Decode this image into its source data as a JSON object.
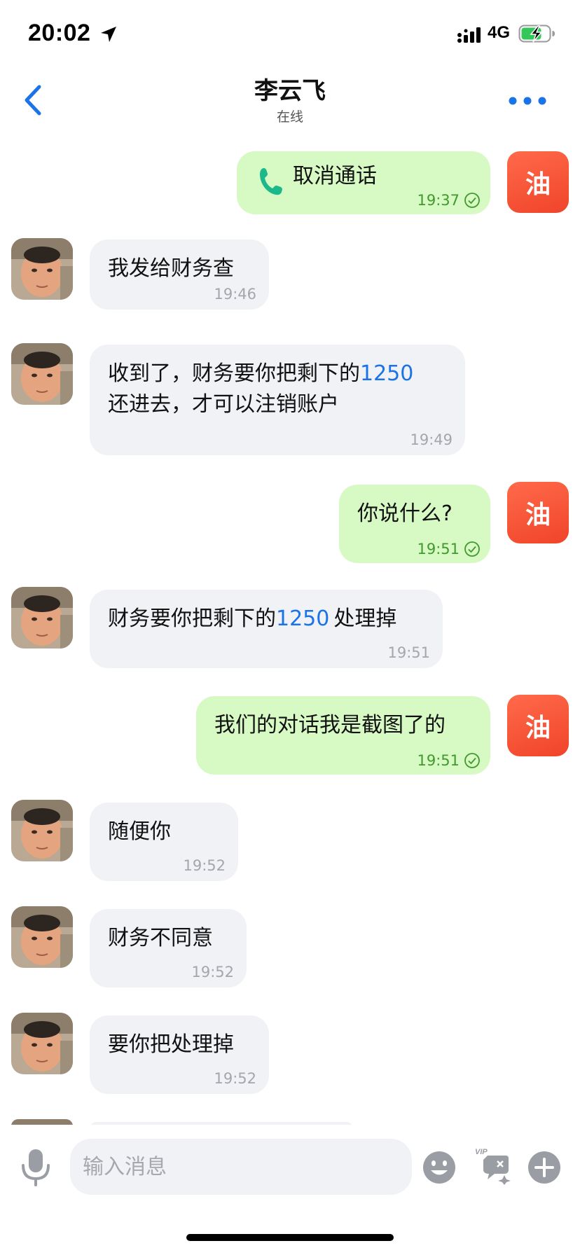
{
  "status_bar": {
    "time": "20:02",
    "network": "4G"
  },
  "nav": {
    "contact_name": "李云飞",
    "contact_status": "在线"
  },
  "colors": {
    "accent": "#1a73e8",
    "outgoing_bubble": "#d7f9c4",
    "incoming_bubble": "#f1f2f6",
    "outgoing_avatar": "#f0442a",
    "read_check": "#3f9a2b"
  },
  "my_avatar_text": "油",
  "messages": [
    {
      "direction": "out",
      "type": "call",
      "text": "取消通话",
      "time": "19:37",
      "icon": "phone-icon"
    },
    {
      "direction": "in",
      "text": "我发给财务查",
      "time": "19:46"
    },
    {
      "direction": "in",
      "line1_prefix": "收到了，财务要你把剩下的",
      "line1_number": "1250",
      "line2": "还进去，才可以注销账户",
      "time": "19:49"
    },
    {
      "direction": "out",
      "text": "你说什么?",
      "time": "19:51"
    },
    {
      "direction": "in",
      "prefix": "财务要你把剩下的",
      "number": "1250",
      "suffix": "处理掉",
      "time": "19:51"
    },
    {
      "direction": "out",
      "text": "我们的对话我是截图了的",
      "time": "19:51"
    },
    {
      "direction": "in",
      "text": "随便你",
      "time": "19:52"
    },
    {
      "direction": "in",
      "text": "财务不同意",
      "time": "19:52"
    },
    {
      "direction": "in",
      "text": "要你把处理掉",
      "time": "19:52"
    }
  ],
  "input": {
    "placeholder": "输入消息",
    "vip_badge": "VIP"
  }
}
